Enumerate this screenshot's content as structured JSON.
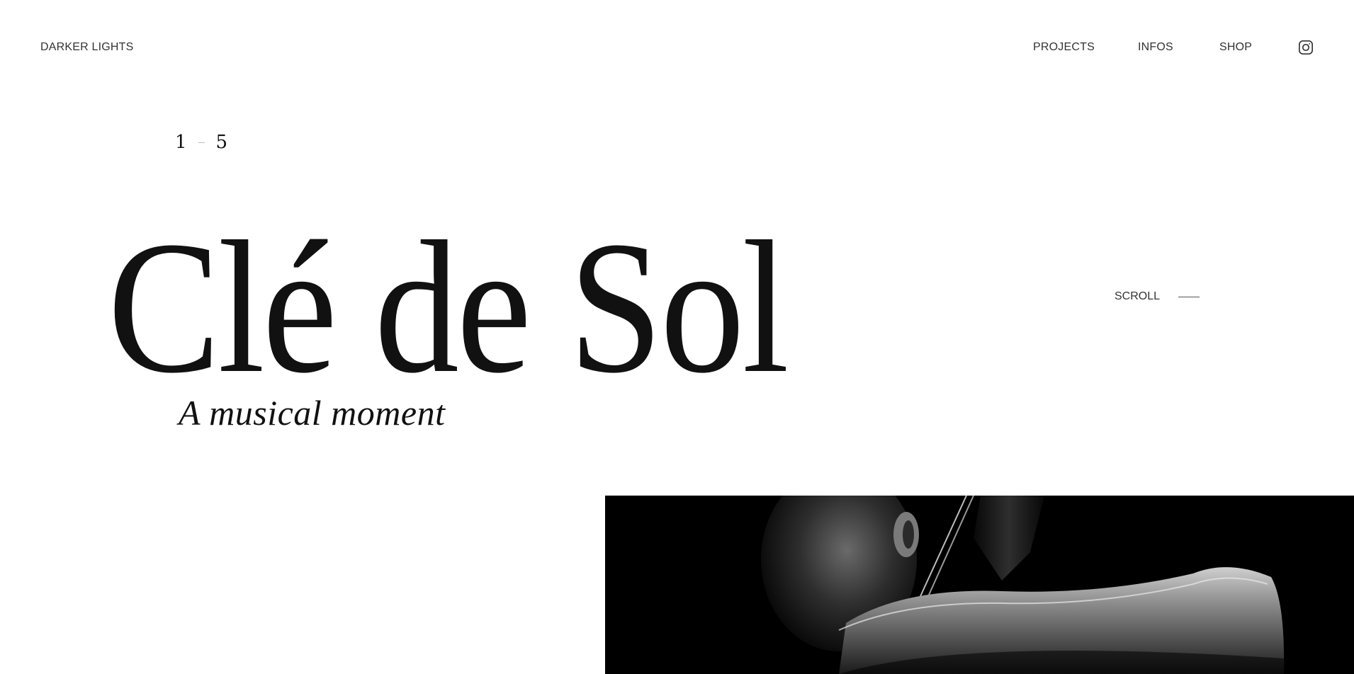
{
  "header": {
    "brand": "DARKER LIGHTS",
    "nav": [
      {
        "label": "PROJECTS"
      },
      {
        "label": "INFOS"
      },
      {
        "label": "SHOP"
      }
    ],
    "social_icon": "instagram-icon"
  },
  "hero": {
    "counter_current": "1",
    "counter_total": "5",
    "title": "Clé de Sol",
    "subtitle": "A musical moment",
    "scroll_label": "SCROLL"
  },
  "colors": {
    "background": "#ffffff",
    "text": "#111111",
    "nav_text": "#333333",
    "photo_background": "#000000"
  }
}
